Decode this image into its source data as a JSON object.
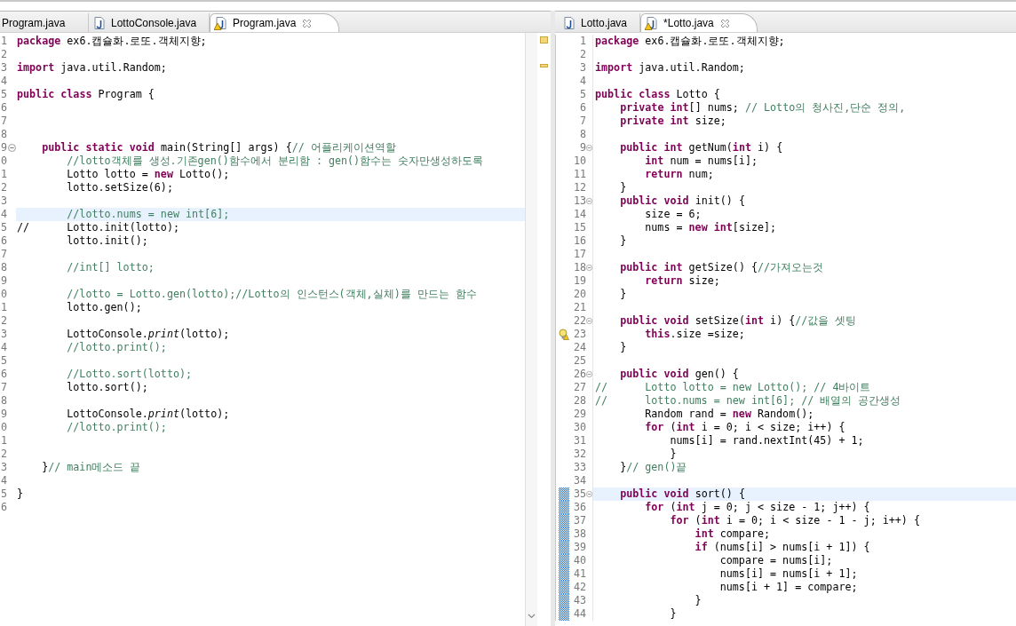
{
  "editors": [
    {
      "tabs": [
        {
          "label": "Program.java",
          "selected": false,
          "icon": false,
          "closable": false
        },
        {
          "label": "LottoConsole.java",
          "selected": false,
          "icon": true,
          "warning": false,
          "closable": false
        },
        {
          "label": "Program.java",
          "selected": true,
          "icon": true,
          "warning": true,
          "closable": true
        }
      ],
      "lines": [
        {
          "n": "1",
          "code": "**package** ex6.캡슐화.로또.객체지향;",
          "selected": false,
          "fold": false,
          "warning": false,
          "changed": false
        },
        {
          "n": "2",
          "selected": false,
          "fold": false,
          "warning": false,
          "changed": false
        },
        {
          "n": "3",
          "code": "**import** java.util.Random;",
          "selected": false,
          "fold": false,
          "warning": false,
          "changed": false
        },
        {
          "n": "4",
          "selected": false,
          "fold": false,
          "warning": false,
          "changed": false
        },
        {
          "n": "5",
          "code": "**public** **class** Program {",
          "selected": false,
          "fold": false,
          "warning": false,
          "changed": false
        },
        {
          "n": "6",
          "selected": false,
          "fold": false,
          "warning": false,
          "changed": false
        },
        {
          "n": "7",
          "selected": false,
          "fold": false,
          "warning": false,
          "changed": false
        },
        {
          "n": "8",
          "selected": false,
          "fold": false,
          "warning": false,
          "changed": false
        },
        {
          "n": "9",
          "code": "    **public** **static** **void** main(String[] args) {",
          "comment": "// 어플리케이션역할",
          "selected": false,
          "fold": true,
          "warning": false,
          "changed": false
        },
        {
          "n": "0",
          "comment": "        //lotto객체를 생성.기존gen()함수에서 분리함 : gen()함수는 숫자만생성하도록",
          "selected": false,
          "fold": false,
          "warning": false,
          "changed": false
        },
        {
          "n": "1",
          "code": "        Lotto lotto = **new** Lotto();",
          "selected": false,
          "fold": false,
          "warning": false,
          "changed": false
        },
        {
          "n": "2",
          "code": "        lotto.setSize(6);",
          "selected": false,
          "fold": false,
          "warning": false,
          "changed": false
        },
        {
          "n": "3",
          "selected": false,
          "fold": false,
          "warning": false,
          "changed": false
        },
        {
          "n": "4",
          "comment": "        //lotto.nums = new int[6];",
          "selected": true,
          "fold": false,
          "warning": false,
          "changed": false
        },
        {
          "n": "5",
          "code": "//      Lotto.init(lotto);",
          "selected": false,
          "fold": false,
          "warning": false,
          "changed": false
        },
        {
          "n": "6",
          "code": "        lotto.init();",
          "selected": false,
          "fold": false,
          "warning": false,
          "changed": false
        },
        {
          "n": "7",
          "selected": false,
          "fold": false,
          "warning": false,
          "changed": false
        },
        {
          "n": "8",
          "comment": "        //int[] lotto;",
          "selected": false,
          "fold": false,
          "warning": false,
          "changed": false
        },
        {
          "n": "9",
          "selected": false,
          "fold": false,
          "warning": false,
          "changed": false
        },
        {
          "n": "0",
          "comment": "        //lotto = Lotto.gen(lotto);//Lotto의 인스턴스(객체,실체)를 만드는 함수",
          "selected": false,
          "fold": false,
          "warning": false,
          "changed": false
        },
        {
          "n": "1",
          "code": "        lotto.gen();",
          "selected": false,
          "fold": false,
          "warning": false,
          "changed": false
        },
        {
          "n": "2",
          "selected": false,
          "fold": false,
          "warning": false,
          "changed": false
        },
        {
          "n": "3",
          "code": "        LottoConsole.*print*(lotto);",
          "selected": false,
          "fold": false,
          "warning": false,
          "changed": false
        },
        {
          "n": "4",
          "comment": "        //lotto.print();",
          "selected": false,
          "fold": false,
          "warning": false,
          "changed": false
        },
        {
          "n": "5",
          "selected": false,
          "fold": false,
          "warning": false,
          "changed": false
        },
        {
          "n": "6",
          "comment": "        //Lotto.sort(lotto);",
          "selected": false,
          "fold": false,
          "warning": false,
          "changed": false
        },
        {
          "n": "7",
          "code": "        lotto.sort();",
          "selected": false,
          "fold": false,
          "warning": false,
          "changed": false
        },
        {
          "n": "8",
          "selected": false,
          "fold": false,
          "warning": false,
          "changed": false
        },
        {
          "n": "9",
          "code": "        LottoConsole.*print*(lotto);",
          "selected": false,
          "fold": false,
          "warning": false,
          "changed": false
        },
        {
          "n": "0",
          "comment": "        //lotto.print();",
          "selected": false,
          "fold": false,
          "warning": false,
          "changed": false
        },
        {
          "n": "1",
          "selected": false,
          "fold": false,
          "warning": false,
          "changed": false
        },
        {
          "n": "2",
          "selected": false,
          "fold": false,
          "warning": false,
          "changed": false
        },
        {
          "n": "3",
          "code": "    }",
          "comment": "// main메소드 끝",
          "selected": false,
          "fold": false,
          "warning": false,
          "changed": false
        },
        {
          "n": "4",
          "selected": false,
          "fold": false,
          "warning": false,
          "changed": false
        },
        {
          "n": "5",
          "code": "}",
          "selected": false,
          "fold": false,
          "warning": false,
          "changed": false
        },
        {
          "n": "6",
          "selected": false,
          "fold": false,
          "warning": false,
          "changed": false
        }
      ]
    },
    {
      "tabs": [
        {
          "label": "Lotto.java",
          "selected": false,
          "icon": true,
          "warning": false,
          "closable": false
        },
        {
          "label": "*Lotto.java",
          "selected": true,
          "icon": true,
          "warning": true,
          "closable": true
        }
      ],
      "lines": [
        {
          "n": "1",
          "code": "**package** ex6.캡슐화.로또.객체지향;",
          "selected": false,
          "fold": false,
          "warning": false,
          "changed": false
        },
        {
          "n": "2",
          "selected": false,
          "fold": false,
          "warning": false,
          "changed": false
        },
        {
          "n": "3",
          "code": "**import** java.util.Random;",
          "selected": false,
          "fold": false,
          "warning": false,
          "changed": false
        },
        {
          "n": "4",
          "selected": false,
          "fold": false,
          "warning": false,
          "changed": false
        },
        {
          "n": "5",
          "code": "**public** **class** Lotto {",
          "selected": false,
          "fold": false,
          "warning": false,
          "changed": false
        },
        {
          "n": "6",
          "code": "    **private** **int**[] nums; ",
          "comment": "// Lotto의 청사진,단순 정의,",
          "selected": false,
          "fold": false,
          "warning": false,
          "changed": false
        },
        {
          "n": "7",
          "code": "    **private** **int** size;",
          "selected": false,
          "fold": false,
          "warning": false,
          "changed": false
        },
        {
          "n": "8",
          "selected": false,
          "fold": false,
          "warning": false,
          "changed": false
        },
        {
          "n": "9",
          "code": "    **public** **int** getNum(**int** i) {",
          "selected": false,
          "fold": true,
          "warning": false,
          "changed": false
        },
        {
          "n": "10",
          "code": "        **int** num = nums[i];",
          "selected": false,
          "fold": false,
          "warning": false,
          "changed": false
        },
        {
          "n": "11",
          "code": "        **return** num;",
          "selected": false,
          "fold": false,
          "warning": false,
          "changed": false
        },
        {
          "n": "12",
          "code": "    }",
          "selected": false,
          "fold": false,
          "warning": false,
          "changed": false
        },
        {
          "n": "13",
          "code": "    **public** **void** init() {",
          "selected": false,
          "fold": true,
          "warning": false,
          "changed": false
        },
        {
          "n": "14",
          "code": "        size = 6;",
          "selected": false,
          "fold": false,
          "warning": false,
          "changed": false
        },
        {
          "n": "15",
          "code": "        nums = **new** **int**[size];",
          "selected": false,
          "fold": false,
          "warning": false,
          "changed": false
        },
        {
          "n": "16",
          "code": "    }",
          "selected": false,
          "fold": false,
          "warning": false,
          "changed": false
        },
        {
          "n": "17",
          "selected": false,
          "fold": false,
          "warning": false,
          "changed": false
        },
        {
          "n": "18",
          "code": "    **public** **int** getSize() {",
          "comment": "//가져오는것",
          "selected": false,
          "fold": true,
          "warning": false,
          "changed": false
        },
        {
          "n": "19",
          "code": "        **return** size;",
          "selected": false,
          "fold": false,
          "warning": false,
          "changed": false
        },
        {
          "n": "20",
          "code": "    }",
          "selected": false,
          "fold": false,
          "warning": false,
          "changed": false
        },
        {
          "n": "21",
          "selected": false,
          "fold": false,
          "warning": false,
          "changed": false
        },
        {
          "n": "22",
          "code": "    **public** **void** setSize(**int** i) {",
          "comment": "//값을 셋팅",
          "selected": false,
          "fold": true,
          "warning": false,
          "changed": false
        },
        {
          "n": "23",
          "code": "        **this**.size =size;",
          "selected": false,
          "fold": false,
          "warning": true,
          "changed": false
        },
        {
          "n": "24",
          "code": "    }",
          "selected": false,
          "fold": false,
          "warning": false,
          "changed": false
        },
        {
          "n": "25",
          "selected": false,
          "fold": false,
          "warning": false,
          "changed": false
        },
        {
          "n": "26",
          "code": "    **public** **void** gen() {",
          "selected": false,
          "fold": true,
          "warning": false,
          "changed": false
        },
        {
          "n": "27",
          "comment": "//      Lotto lotto = new Lotto(); // 4바이트",
          "selected": false,
          "fold": false,
          "warning": false,
          "changed": false
        },
        {
          "n": "28",
          "comment": "//      lotto.nums = new int[6]; // 배열의 공간생성",
          "selected": false,
          "fold": false,
          "warning": false,
          "changed": false
        },
        {
          "n": "29",
          "code": "        Random rand = **new** Random();",
          "selected": false,
          "fold": false,
          "warning": false,
          "changed": false
        },
        {
          "n": "30",
          "code": "        **for** (**int** i = 0; i < size; i++) {",
          "selected": false,
          "fold": false,
          "warning": false,
          "changed": false
        },
        {
          "n": "31",
          "code": "            nums[i] = rand.nextInt(45) + 1;",
          "selected": false,
          "fold": false,
          "warning": false,
          "changed": false
        },
        {
          "n": "32",
          "code": "            }",
          "selected": false,
          "fold": false,
          "warning": false,
          "changed": false
        },
        {
          "n": "33",
          "code": "    }",
          "comment": "// gen()끝",
          "selected": false,
          "fold": false,
          "warning": false,
          "changed": false
        },
        {
          "n": "34",
          "selected": false,
          "fold": false,
          "warning": false,
          "changed": false
        },
        {
          "n": "35",
          "code": "    **public** **void** sort() {",
          "selected": true,
          "fold": true,
          "warning": false,
          "changed": true
        },
        {
          "n": "36",
          "code": "        **for** (**int** j = 0; j < size - 1; j++) {",
          "selected": false,
          "fold": false,
          "warning": false,
          "changed": true
        },
        {
          "n": "37",
          "code": "            **for** (**int** i = 0; i < size - 1 - j; i++) {",
          "selected": false,
          "fold": false,
          "warning": false,
          "changed": true
        },
        {
          "n": "38",
          "code": "                **int** compare;",
          "selected": false,
          "fold": false,
          "warning": false,
          "changed": true
        },
        {
          "n": "39",
          "code": "                **if** (nums[i] > nums[i + 1]) {",
          "selected": false,
          "fold": false,
          "warning": false,
          "changed": true
        },
        {
          "n": "40",
          "code": "                    compare = nums[i];",
          "selected": false,
          "fold": false,
          "warning": false,
          "changed": true
        },
        {
          "n": "41",
          "code": "                    nums[i] = nums[i + 1];",
          "selected": false,
          "fold": false,
          "warning": false,
          "changed": true
        },
        {
          "n": "42",
          "code": "                    nums[i + 1] = compare;",
          "selected": false,
          "fold": false,
          "warning": false,
          "changed": true
        },
        {
          "n": "43",
          "code": "                }",
          "selected": false,
          "fold": false,
          "warning": false,
          "changed": true
        },
        {
          "n": "44",
          "code": "            }",
          "selected": false,
          "fold": false,
          "warning": false,
          "changed": true
        }
      ]
    }
  ]
}
